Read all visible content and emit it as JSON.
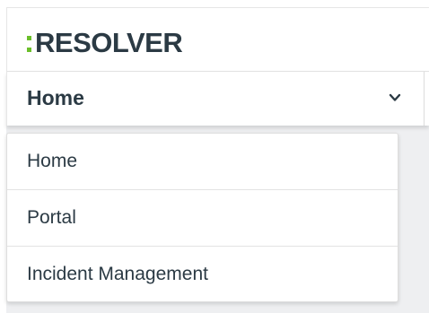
{
  "header": {
    "logo_text": "RESOLVER"
  },
  "nav": {
    "selected_label": "Home",
    "options": [
      {
        "label": "Home"
      },
      {
        "label": "Portal"
      },
      {
        "label": "Incident Management"
      }
    ]
  },
  "colors": {
    "logo_accent": "#6bbf2a",
    "text_dark": "#2b3a44",
    "background_gray": "#eeeff1"
  },
  "icons": {
    "dropdown": "chevron-down-icon"
  }
}
